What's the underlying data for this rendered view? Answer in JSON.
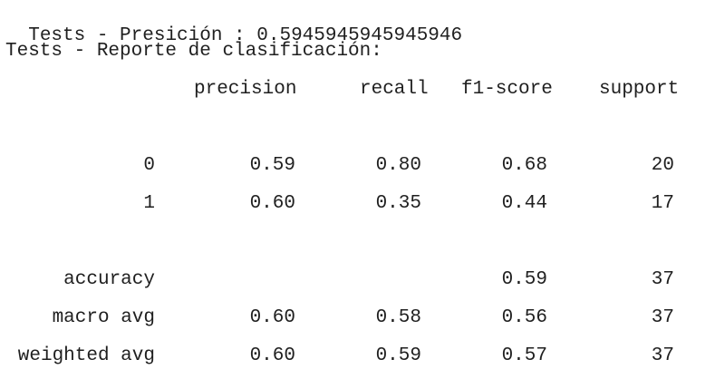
{
  "accuracy_line": {
    "label": "Tests - Presición : ",
    "value": "0.5945945945945946"
  },
  "report_title": "Tests - Reporte de clasificación:",
  "headers": [
    "precision",
    "recall",
    "f1-score",
    "support"
  ],
  "rows": [
    {
      "label": "0",
      "precision": "0.59",
      "recall": "0.80",
      "f1": "0.68",
      "support": "20"
    },
    {
      "label": "1",
      "precision": "0.60",
      "recall": "0.35",
      "f1": "0.44",
      "support": "17"
    }
  ],
  "summary_rows": [
    {
      "label": "accuracy",
      "precision": "",
      "recall": "",
      "f1": "0.59",
      "support": "37"
    },
    {
      "label": "macro avg",
      "precision": "0.60",
      "recall": "0.58",
      "f1": "0.56",
      "support": "37"
    },
    {
      "label": "weighted avg",
      "precision": "0.60",
      "recall": "0.59",
      "f1": "0.57",
      "support": "37"
    }
  ]
}
